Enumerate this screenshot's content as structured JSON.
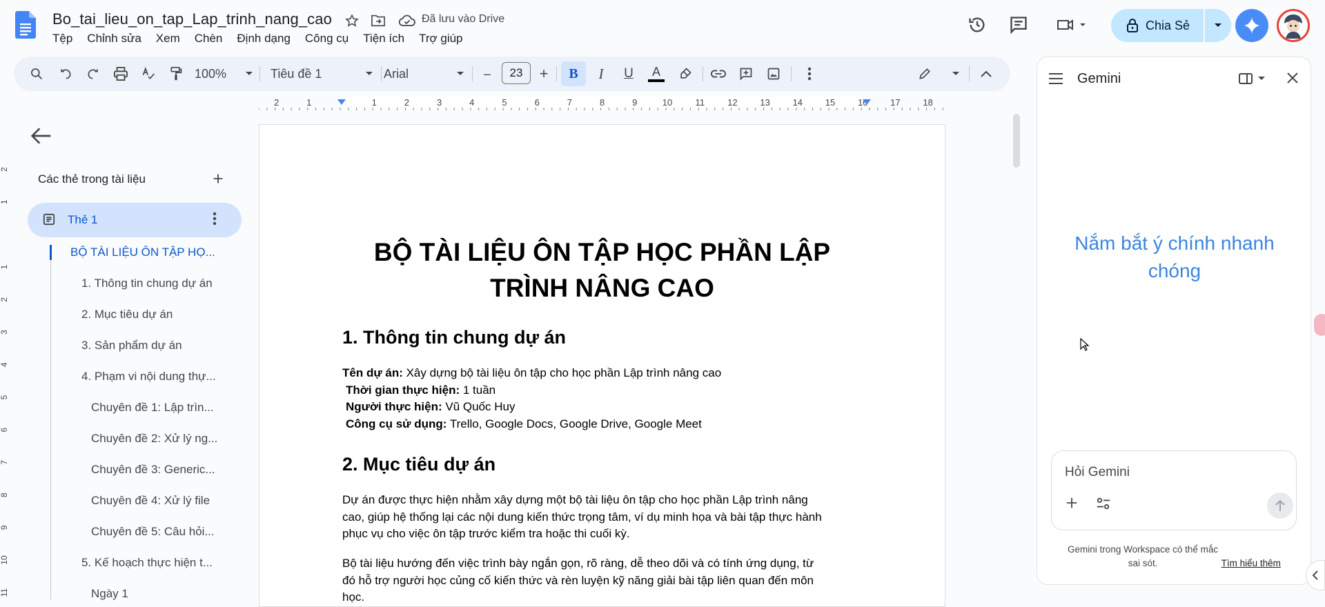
{
  "header": {
    "doc_title": "Bo_tai_lieu_on_tap_Lap_trinh_nang_cao",
    "saved_status": "Đã lưu vào Drive",
    "share_label": "Chia Sẻ"
  },
  "menu": [
    "Tệp",
    "Chỉnh sửa",
    "Xem",
    "Chèn",
    "Định dạng",
    "Công cụ",
    "Tiện ích",
    "Trợ giúp"
  ],
  "toolbar": {
    "zoom": "100%",
    "style": "Tiêu đề 1",
    "font": "Arial",
    "font_size": "23",
    "bold_label": "B",
    "italic_label": "I",
    "underline_label": "U",
    "text_color_label": "A",
    "minus_label": "–",
    "plus_label": "+"
  },
  "ruler": {
    "h_labels": [
      "2",
      "1",
      "1",
      "2",
      "3",
      "4",
      "5",
      "6",
      "7",
      "8",
      "9",
      "10",
      "11",
      "12",
      "13",
      "14",
      "15",
      "16",
      "17",
      "18"
    ],
    "v_labels": [
      "2",
      "1",
      "1",
      "2",
      "3",
      "4",
      "5",
      "6",
      "7",
      "8",
      "9",
      "10",
      "11"
    ]
  },
  "outline": {
    "heading": "Các thẻ trong tài liệu",
    "tab_label": "Thẻ 1",
    "items": [
      {
        "label": "BỘ TÀI LIỆU ÔN TẬP HỌ...",
        "active": true
      },
      {
        "label": "1. Thông tin chung dự án"
      },
      {
        "label": "2. Mục tiêu dự án"
      },
      {
        "label": "3. Sản phẩm dự án"
      },
      {
        "label": "4. Phạm vi nội dung thự..."
      },
      {
        "label": "Chuyên đề 1: Lập trìn..."
      },
      {
        "label": "Chuyên đề 2: Xử lý ng..."
      },
      {
        "label": "Chuyên đề 3: Generic..."
      },
      {
        "label": "Chuyên đề 4: Xử lý file"
      },
      {
        "label": "Chuyên đề 5: Câu hỏi..."
      },
      {
        "label": "5. Kế hoạch thực hiện t..."
      },
      {
        "label": "Ngày 1"
      }
    ]
  },
  "document": {
    "title_line1": "BỘ TÀI LIỆU ÔN TẬP HỌC PHẦN LẬP",
    "title_line2": "TRÌNH NÂNG CAO",
    "section1_heading": "1. Thông tin chung dự án",
    "info": [
      {
        "label": "Tên dự án:",
        "value": " Xây dựng bộ tài liệu ôn tập cho học phần Lập trình nâng cao"
      },
      {
        "label": "Thời gian thực hiện:",
        "value": " 1 tuần"
      },
      {
        "label": "Người thực hiện:",
        "value": " Vũ Quốc Huy"
      },
      {
        "label": "Công cụ sử dụng:",
        "value": " Trello, Google Docs, Google Drive, Google Meet"
      }
    ],
    "section2_heading": "2. Mục tiêu dự án",
    "para1": [
      "Dự án được thực hiện nhằm xây dựng một bộ tài liệu ôn tập cho học phần Lập trình nâng",
      "cao, giúp hệ thống lại các nội dung kiến thức trọng tâm, ví dụ minh họa và bài tập thực hành",
      "phục vụ cho việc ôn tập trước kiểm tra hoặc thi cuối kỳ."
    ],
    "para2": [
      "Bộ tài liệu hướng đến việc trình bày ngắn gọn, rõ ràng, dễ theo dõi và có tính ứng dụng, từ",
      "đó hỗ trợ người học củng cố kiến thức và rèn luyện kỹ năng giải bài tập liên quan đến môn",
      "học."
    ]
  },
  "gemini": {
    "title": "Gemini",
    "hero": "Nắm bắt ý chính nhanh chóng",
    "input_placeholder": "Hỏi Gemini",
    "footer_text": "Gemini trong Workspace có thể mắc sai sót.",
    "footer_link": "Tìm hiểu thêm"
  },
  "colors": {
    "accent": "#0b57d0",
    "share_bg": "#c2e7ff",
    "toolbar_bg": "#edf2fa",
    "gemini_hero": "#3b84e0"
  }
}
